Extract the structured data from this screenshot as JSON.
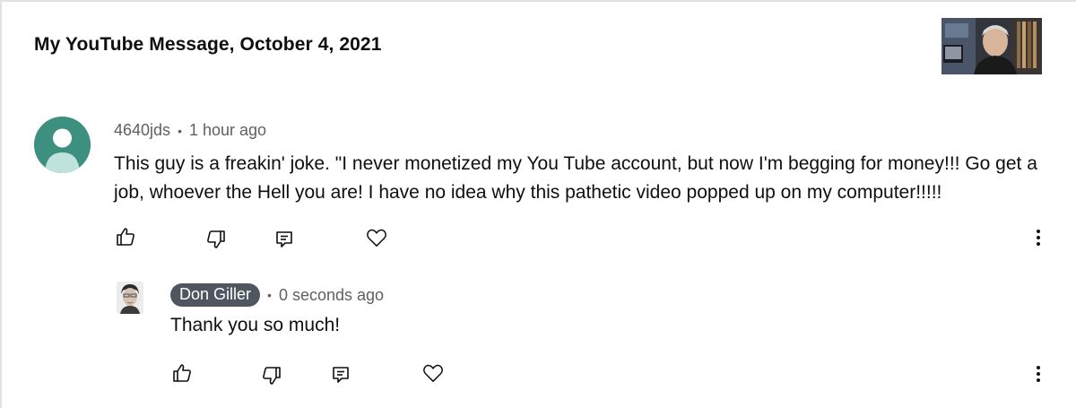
{
  "header": {
    "title": "My YouTube Message, October 4, 2021"
  },
  "comment": {
    "author": "4640jds",
    "separator": "•",
    "time": "1 hour ago",
    "text": "This guy is a freakin' joke.  \"I never monetized my You Tube account, but now I'm begging for money!!!  Go get a job, whoever the Hell you are!  I have no idea why this pathetic video popped up on my computer!!!!!",
    "avatar_color": "#3d8f80"
  },
  "reply": {
    "author": "Don Giller",
    "separator": "•",
    "time": "0 seconds ago",
    "text": "Thank you so much!",
    "chip_color": "#505660"
  },
  "icons": {
    "like": "thumbs-up-icon",
    "dislike": "thumbs-down-icon",
    "reply": "reply-icon",
    "heart": "heart-icon",
    "more": "more-vertical-icon"
  }
}
